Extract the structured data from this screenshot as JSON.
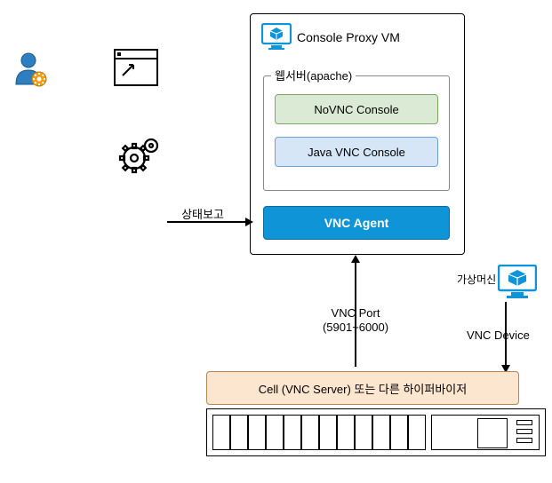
{
  "proxy_vm": {
    "title": "Console Proxy VM",
    "webserver_legend": "웹서버(apache)",
    "novnc_label": "NoVNC Console",
    "javavnc_label": "Java VNC Console",
    "vnc_agent_label": "VNC Agent"
  },
  "labels": {
    "status_report": "상태보고",
    "vnc_port_line1": "VNC Port",
    "vnc_port_line2": "(5901~6000)",
    "vm_label": "가상머신",
    "vnc_device": "VNC Device"
  },
  "cell": {
    "label": "Cell (VNC Server) 또는 다른 하이퍼바이저"
  },
  "icons": {
    "user": "user-admin-icon",
    "browser": "browser-window-icon",
    "gears": "gears-icon",
    "monitor_cube": "monitor-cube-icon",
    "vm_monitor": "monitor-cube-icon"
  }
}
